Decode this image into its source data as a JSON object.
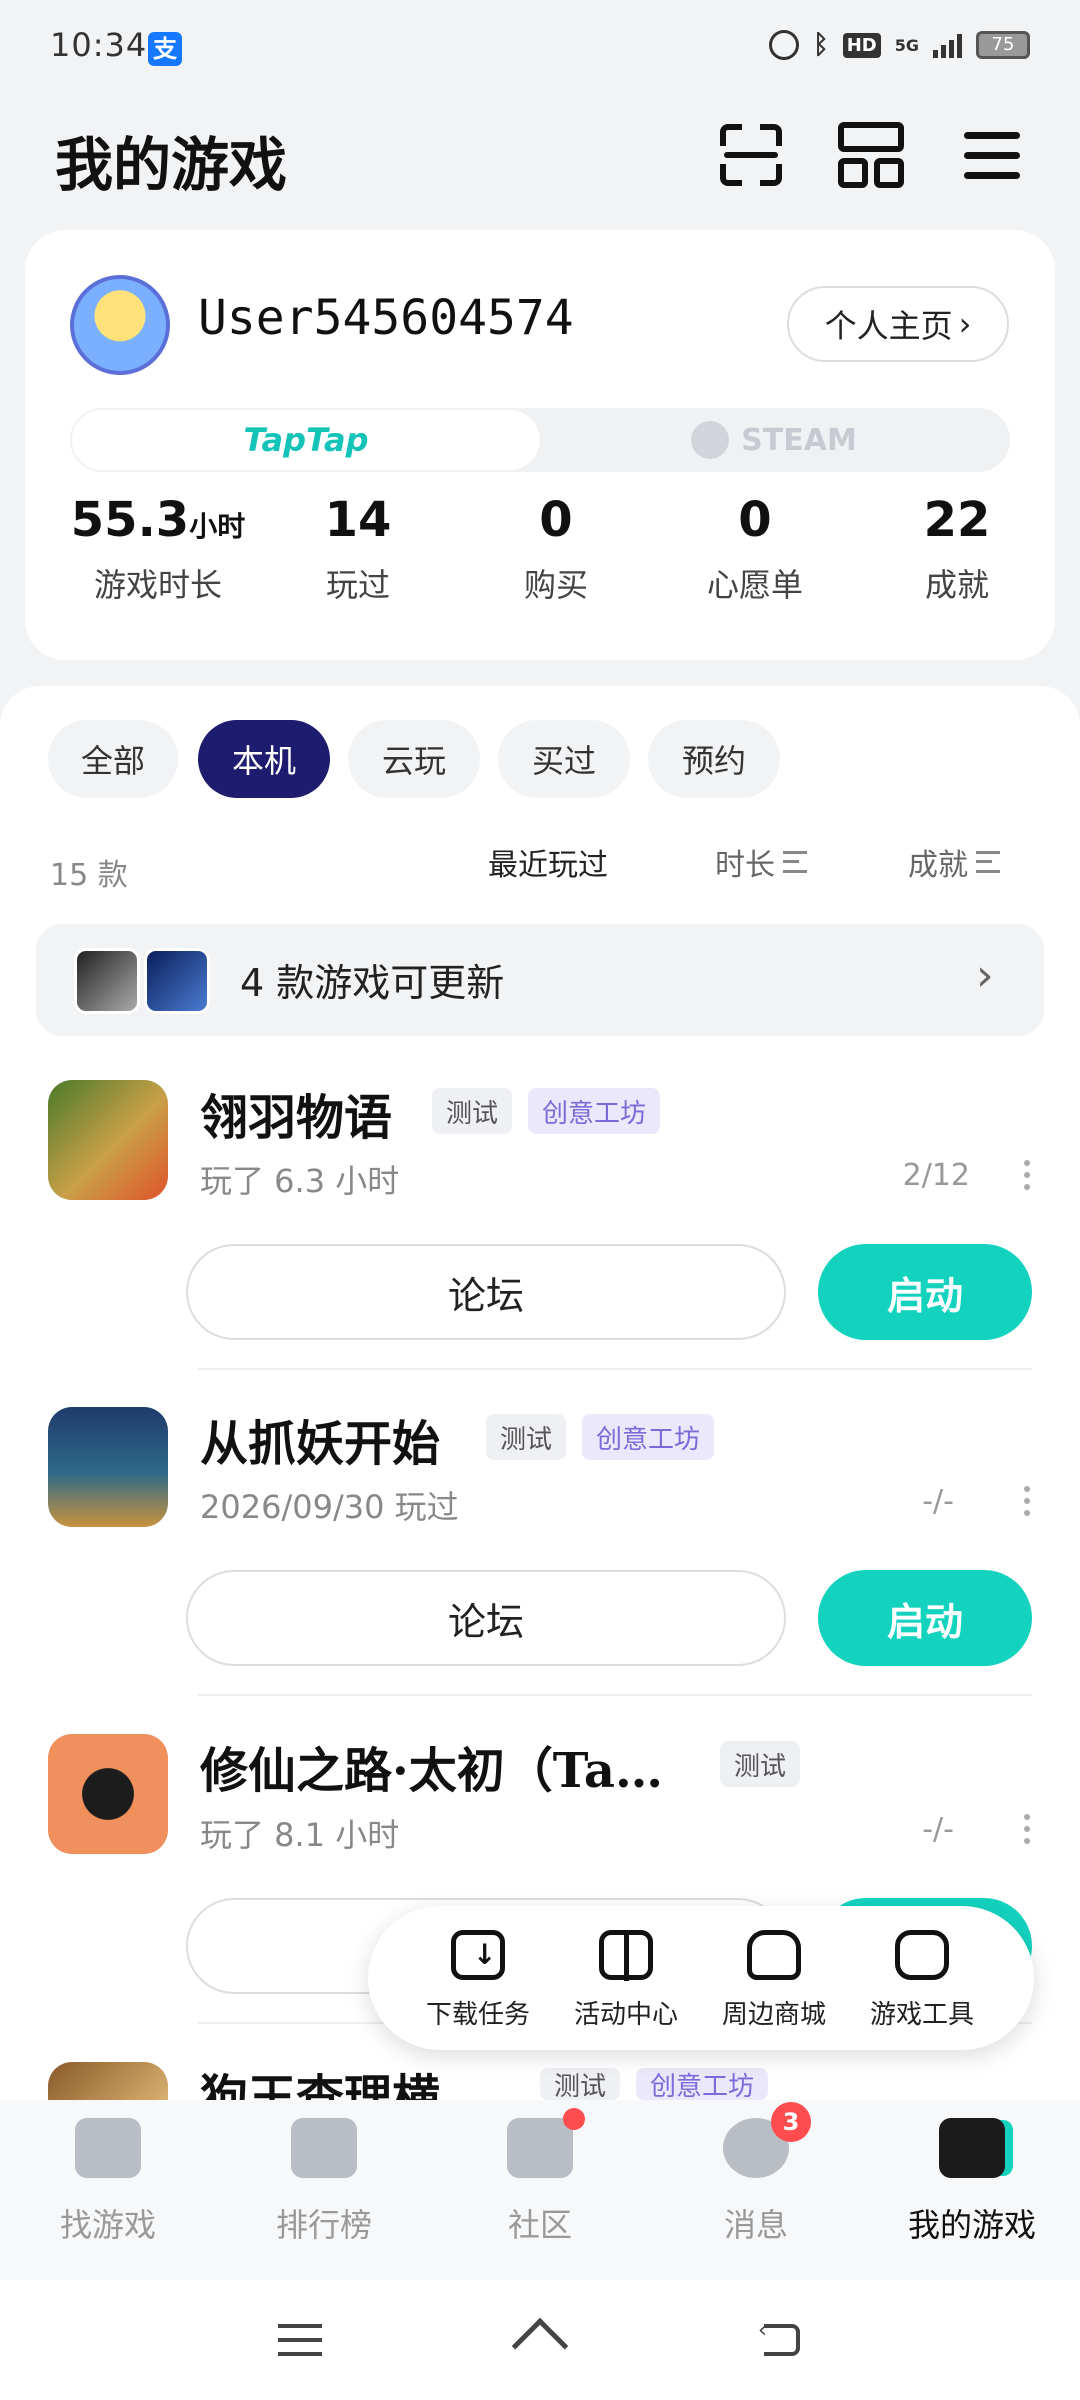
{
  "status_bar": {
    "time": "10:34",
    "alipay_glyph": "支",
    "hd": "HD",
    "network": "5G",
    "battery": "75"
  },
  "header": {
    "title": "我的游戏"
  },
  "profile": {
    "username": "User545604574",
    "home_button": "个人主页",
    "platforms": [
      "TapTap",
      "STEAM"
    ],
    "stats": [
      {
        "value": "55.3",
        "unit": "小时",
        "label": "游戏时长"
      },
      {
        "value": "14",
        "unit": "",
        "label": "玩过"
      },
      {
        "value": "0",
        "unit": "",
        "label": "购买"
      },
      {
        "value": "0",
        "unit": "",
        "label": "心愿单"
      },
      {
        "value": "22",
        "unit": "",
        "label": "成就"
      }
    ]
  },
  "filters": {
    "chips": [
      "全部",
      "本机",
      "云玩",
      "买过",
      "预约"
    ],
    "active": "本机"
  },
  "sort_bar": {
    "count": "15 款",
    "options": [
      "最近玩过",
      "时长",
      "成就"
    ]
  },
  "update_banner": {
    "text": "4 款游戏可更新"
  },
  "games": [
    {
      "name": "翎羽物语",
      "tags": [
        "测试",
        "创意工坊"
      ],
      "subtitle": "玩了 6.3 小时",
      "progress": "2/12",
      "forum": "论坛",
      "launch": "启动"
    },
    {
      "name": "从抓妖开始",
      "tags": [
        "测试",
        "创意工坊"
      ],
      "subtitle": "2026/09/30 玩过",
      "progress": "-/-",
      "forum": "论坛",
      "launch": "启动"
    },
    {
      "name": "修仙之路·太初（Ta…",
      "tags": [
        "测试"
      ],
      "subtitle": "玩了 8.1 小时",
      "progress": "-/-"
    },
    {
      "name": "狗王查理横…",
      "tags": [
        "测试",
        "创意工坊"
      ]
    }
  ],
  "quick_menu": [
    "下载任务",
    "活动中心",
    "周边商城",
    "游戏工具"
  ],
  "bottom_nav": {
    "items": [
      "找游戏",
      "排行榜",
      "社区",
      "消息",
      "我的游戏"
    ],
    "active": "我的游戏",
    "message_badge": "3"
  },
  "colors": {
    "accent": "#13d3bf",
    "active_chip": "#1e1c6e",
    "workshop_tag": "#7c6ad9",
    "badge": "#ff4d4f"
  }
}
